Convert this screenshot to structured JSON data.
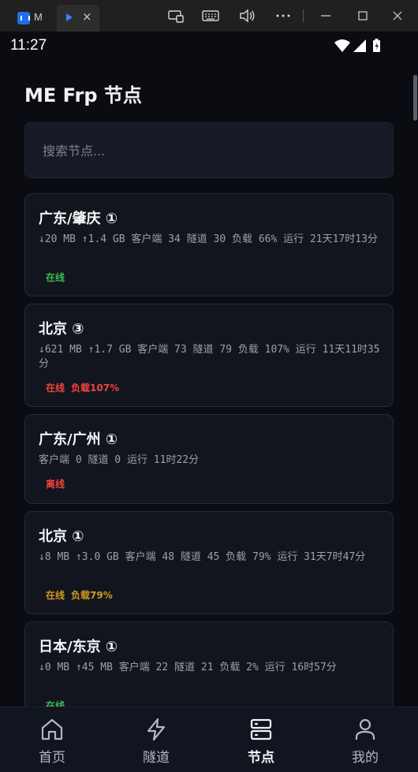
{
  "window": {
    "tab1_title": "M",
    "tab2_close": "×",
    "controls": [
      "screen-rotation-icon",
      "keyboard-icon",
      "volume-icon",
      "more-icon",
      "minimize-icon",
      "maximize-icon",
      "close-icon"
    ]
  },
  "status": {
    "time": "11:27"
  },
  "page": {
    "title": "ME Frp 节点"
  },
  "search": {
    "placeholder": "搜索节点..."
  },
  "nodes": [
    {
      "name": "广东/肇庆 ①",
      "stats": "↓20 MB  ↑1.4 GB  客户端 34  隧道 30  负载 66%  运行 21天17时13分",
      "status": "在线",
      "load_badge": ""
    },
    {
      "name": "北京 ③",
      "stats": "↓621 MB  ↑1.7 GB  客户端 73  隧道 79  负载 107%  运行 11天11时35分",
      "status": "在线",
      "load_badge": "负载107%"
    },
    {
      "name": "广东/广州 ①",
      "stats": "客户端 0  隧道 0  运行 11时22分",
      "status": "离线",
      "load_badge": ""
    },
    {
      "name": "北京 ①",
      "stats": "↓8 MB  ↑3.0 GB  客户端 48  隧道 45  负载 79%  运行 31天7时47分",
      "status": "在线",
      "load_badge": "负载79%"
    },
    {
      "name": "日本/东京 ①",
      "stats": "↓0 MB  ↑45 MB  客户端 22  隧道 21  负载 2%  运行 16时57分",
      "status": "在线",
      "load_badge": ""
    }
  ],
  "colors": {
    "online": "#3fb950",
    "warning": "#d29922",
    "critical": "#f0453a",
    "offline": "#f0453a"
  },
  "nav": [
    {
      "label": "首页",
      "icon": "home-icon",
      "active": false
    },
    {
      "label": "隧道",
      "icon": "lightning-icon",
      "active": false
    },
    {
      "label": "节点",
      "icon": "server-icon",
      "active": true
    },
    {
      "label": "我的",
      "icon": "user-icon",
      "active": false
    }
  ]
}
